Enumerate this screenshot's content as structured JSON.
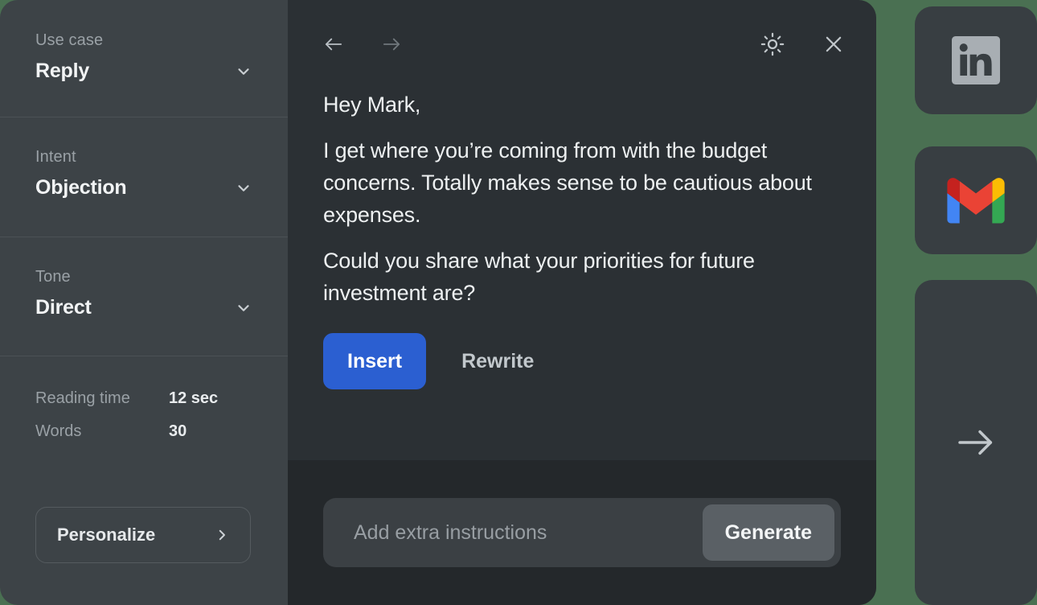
{
  "theme": {
    "page_background": "#4a7052",
    "sidebar_background": "#3d4347",
    "panel_background": "#2b3034",
    "footer_background": "#24282b",
    "accent_blue": "#2b5fd1",
    "muted_text": "#9aa1a6",
    "primary_text": "#edf0f1"
  },
  "sidebar": {
    "fields": [
      {
        "label": "Use case",
        "value": "Reply",
        "icon": "chevron-down-icon"
      },
      {
        "label": "Intent",
        "value": "Objection",
        "icon": "chevron-down-icon"
      },
      {
        "label": "Tone",
        "value": "Direct",
        "icon": "chevron-down-icon"
      }
    ],
    "stats": [
      {
        "label": "Reading time",
        "value": "12 sec"
      },
      {
        "label": "Words",
        "value": "30"
      }
    ],
    "personalize": {
      "label": "Personalize",
      "icon": "chevron-right-icon"
    }
  },
  "topbar": {
    "back_icon": "arrow-left-icon",
    "forward_icon": "arrow-right-icon",
    "theme_icon": "sun-icon",
    "close_icon": "close-icon"
  },
  "message": {
    "paragraphs": [
      "Hey Mark,",
      "I get where you’re coming from with the budget concerns. Totally makes sense to be cautious about expenses.",
      "Could you share what your priorities for future investment are?"
    ]
  },
  "actions": {
    "insert_label": "Insert",
    "rewrite_label": "Rewrite"
  },
  "composer": {
    "placeholder": "Add extra instructions",
    "value": "",
    "generate_label": "Generate"
  },
  "rail": {
    "cards": [
      {
        "name": "linkedin",
        "icon": "linkedin-icon"
      },
      {
        "name": "gmail",
        "icon": "gmail-icon"
      },
      {
        "name": "expand",
        "icon": "arrow-right-icon"
      }
    ]
  }
}
